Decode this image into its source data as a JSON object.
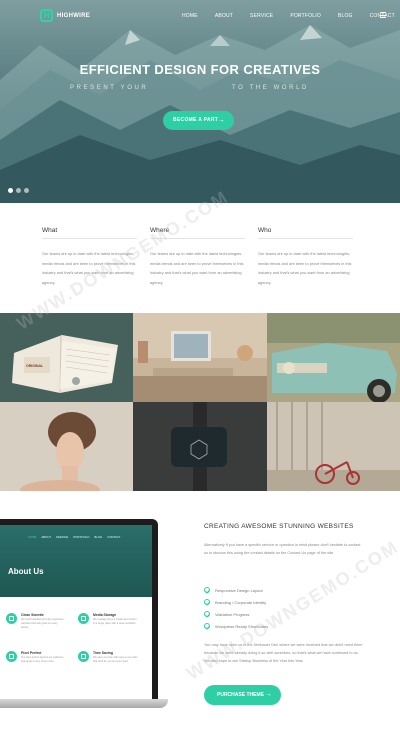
{
  "brand": {
    "logo_letter": "H",
    "name": "HIGHWIRE"
  },
  "nav": {
    "items": [
      "HOME",
      "ABOUT",
      "SERVICE",
      "PORTFOLIO",
      "BLOG",
      "CONTACT"
    ]
  },
  "hero": {
    "title": "EFFICIENT DESIGN FOR CREATIVES",
    "sub_left": "PRESENT YOUR",
    "sub_right": "TO THE WORLD",
    "cta": "BECOME A PART",
    "cta_arrow": "→"
  },
  "columns": [
    {
      "title": "What",
      "text": "Our teams are up to date with the latest technologies, media trends and are keen to prove themselves in this industry and that's what you want from an advertising agency."
    },
    {
      "title": "Where",
      "text": "Our teams are up to date with the latest technologies, media trends and are keen to prove themselves in this industry and that's what you want from an advertising agency."
    },
    {
      "title": "Who",
      "text": "Our teams are up to date with the latest technologies, media trends and are keen to prove themselves in this industry and that's what you want from an advertising agency."
    }
  ],
  "photo_book_text": "ORIGINAL",
  "laptop": {
    "nav": [
      "HOME",
      "ABOUT",
      "SERVICE",
      "PORTFOLIO",
      "BLOG",
      "CONTACT"
    ],
    "title": "About Us",
    "features": [
      {
        "title": "Clean Sweetie",
        "text": "We build beautiful and fully responsive websites that look great on every device."
      },
      {
        "title": "Media Storage",
        "text": "We manage all your media and content in a single place with a clean workflow."
      },
      {
        "title": "Pixel Perfect",
        "text": "Our pixel perfect layouts are crafted to look great on any screen size."
      },
      {
        "title": "Time Saving",
        "text": "We save you time with easy to use tools that work for you and your team."
      }
    ]
  },
  "about": {
    "title": "CREATING AWESOME STUNNING WEBSITES",
    "intro": "Alternatively if you have a specific service or question in mind please don't hesitate to contact us to discuss this using the contact details on the Contact Us page of the site.",
    "checks": [
      "Responsive Design Layout",
      "Branding / Corporate Identity",
      "Validation Progress",
      "Wordpress Ready Shortcodes"
    ],
    "outro": "You may have seen us in the Dimbauer Den where we were received that we didn't need them because we were already doing it so well ourselves, so that's what we have continued to do. We also hope to win Startup Business of the Year this Year.",
    "button": "PURCHASE THEME",
    "button_arrow": "→"
  },
  "watermark": "WWW.DOWNGEMO.COM",
  "colors": {
    "accent": "#2fcfa6",
    "hero_dark": "#2f555b",
    "text": "#888888"
  },
  "slider": {
    "dot_count": 3,
    "active_index": 0
  }
}
